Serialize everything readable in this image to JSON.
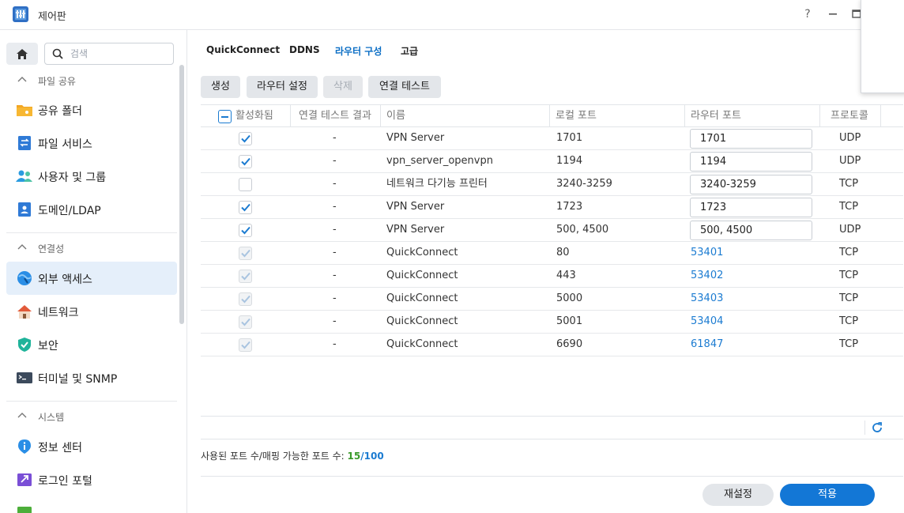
{
  "window": {
    "title": "제어판"
  },
  "sidebar": {
    "search": {
      "placeholder": "검색"
    },
    "sections": {
      "file_sharing": "파일 공유",
      "connectivity": "연결성",
      "system": "시스템"
    },
    "items": {
      "shared_folder": "공유 폴더",
      "file_services": "파일 서비스",
      "user_group": "사용자 및 그룹",
      "domain_ldap": "도메인/LDAP",
      "external_access": "외부 액세스",
      "network": "네트워크",
      "security": "보안",
      "terminal_snmp": "터미널 및 SNMP",
      "info_center": "정보 센터",
      "login_portal": "로그인 포털"
    },
    "active_item": "external_access"
  },
  "tabs": [
    "QuickConnect",
    "DDNS",
    "라우터 구성",
    "고급"
  ],
  "active_tab": "라우터 구성",
  "toolbar": {
    "create": "생성",
    "router_settings": "라우터 설정",
    "delete": "삭제",
    "connection_test": "연결 테스트"
  },
  "table": {
    "headers": {
      "enabled": "활성화됨",
      "test_result": "연결 테스트 결과",
      "name": "이름",
      "local_port": "로컬 포트",
      "router_port": "라우터 포트",
      "protocol": "프로토콜"
    },
    "rows": [
      {
        "enabled": true,
        "editable": true,
        "result": "-",
        "name": "VPN Server",
        "local": "1701",
        "router": "1701",
        "protocol": "UDP"
      },
      {
        "enabled": true,
        "editable": true,
        "result": "-",
        "name": "vpn_server_openvpn",
        "local": "1194",
        "router": "1194",
        "protocol": "UDP"
      },
      {
        "enabled": false,
        "editable": true,
        "result": "-",
        "name": "네트워크 다기능 프린터",
        "local": "3240-3259",
        "router": "3240-3259",
        "protocol": "TCP"
      },
      {
        "enabled": true,
        "editable": true,
        "result": "-",
        "name": "VPN Server",
        "local": "1723",
        "router": "1723",
        "protocol": "TCP"
      },
      {
        "enabled": true,
        "editable": true,
        "result": "-",
        "name": "VPN Server",
        "local": "500, 4500",
        "router": "500, 4500",
        "protocol": "UDP"
      },
      {
        "enabled": true,
        "editable": false,
        "result": "-",
        "name": "QuickConnect",
        "local": "80",
        "router": "53401",
        "protocol": "TCP"
      },
      {
        "enabled": true,
        "editable": false,
        "result": "-",
        "name": "QuickConnect",
        "local": "443",
        "router": "53402",
        "protocol": "TCP"
      },
      {
        "enabled": true,
        "editable": false,
        "result": "-",
        "name": "QuickConnect",
        "local": "5000",
        "router": "53403",
        "protocol": "TCP"
      },
      {
        "enabled": true,
        "editable": false,
        "result": "-",
        "name": "QuickConnect",
        "local": "5001",
        "router": "53404",
        "protocol": "TCP"
      },
      {
        "enabled": true,
        "editable": false,
        "result": "-",
        "name": "QuickConnect",
        "local": "6690",
        "router": "61847",
        "protocol": "TCP"
      }
    ]
  },
  "usage": {
    "label": "사용된 포트 수/매핑 가능한 포트 수: ",
    "used": "15",
    "slash": "/",
    "total": "100"
  },
  "buttons": {
    "reset": "재설정",
    "apply": "적용"
  },
  "colors": {
    "accent": "#1377d6",
    "link": "#1b7bd1",
    "used": "#3a9a2b"
  }
}
